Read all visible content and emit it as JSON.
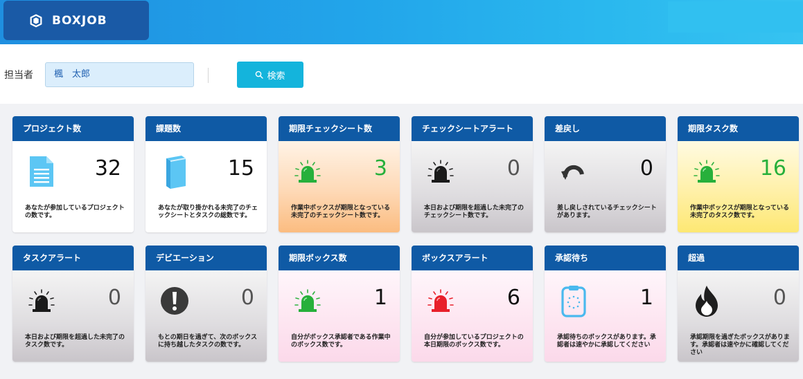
{
  "header": {
    "logo_text": "BOXJOB",
    "colors": {
      "header_gradient_start": "#1f8fe0",
      "header_gradient_end": "#36c3f1",
      "logo_bg": "#1a5aa6"
    }
  },
  "filter": {
    "assignee_label": "担当者",
    "assignee_value": "楓　太郎",
    "search_label": "検索",
    "search_icon": "search-icon"
  },
  "cards": [
    {
      "title": "プロジェクト数",
      "value": "32",
      "desc": "あなたが参加しているプロジェクトの数です。",
      "icon": "document-icon",
      "theme": "white",
      "value_color": "#111111"
    },
    {
      "title": "課題数",
      "value": "15",
      "desc": "あなたが取り掛かれる未完了のチェックシートとタスクの総数です。",
      "icon": "book-icon",
      "theme": "white",
      "value_color": "#111111"
    },
    {
      "title": "期限チェックシート数",
      "value": "3",
      "desc": "作業中ボックスが期限となっている未完了のチェックシート数です。",
      "icon": "siren-green-icon",
      "theme": "orange",
      "value_color": "#27b03b"
    },
    {
      "title": "チェックシートアラート",
      "value": "0",
      "desc": "本日および期限を超過した未完了のチェックシート数です。",
      "icon": "siren-black-icon",
      "theme": "gray",
      "value_color": "#555555"
    },
    {
      "title": "差戻し",
      "value": "0",
      "desc": "差し戻しされているチェックシートがあります。",
      "icon": "undo-arrow-icon",
      "theme": "gray",
      "value_color": "#111111"
    },
    {
      "title": "期限タスク数",
      "value": "16",
      "desc": "作業中ボックスが期限となっている未完了のタスク数です。",
      "icon": "siren-green-icon",
      "theme": "yellow",
      "value_color": "#27b03b"
    },
    {
      "title": "タスクアラート",
      "value": "0",
      "desc": "本日および期限を超過した未完了のタスク数です。",
      "icon": "siren-black-icon",
      "theme": "gray",
      "value_color": "#555555"
    },
    {
      "title": "デビエーション",
      "value": "0",
      "desc": "もとの期日を過ぎて、次のボックスに持ち越したタスクの数です。",
      "icon": "exclamation-icon",
      "theme": "gray",
      "value_color": "#555555"
    },
    {
      "title": "期限ボックス数",
      "value": "1",
      "desc": "自分がボックス承認者である作業中のボックス数です。",
      "icon": "siren-green-icon",
      "theme": "pink",
      "value_color": "#111111"
    },
    {
      "title": "ボックスアラート",
      "value": "6",
      "desc": "自分が参加しているプロジェクトの本日期限のボックス数です。",
      "icon": "siren-red-icon",
      "theme": "pink",
      "value_color": "#111111"
    },
    {
      "title": "承認待ち",
      "value": "1",
      "desc": "承認待ちのボックスがあります。承認者は速やかに承認してください",
      "icon": "clipboard-icon",
      "theme": "pink",
      "value_color": "#111111"
    },
    {
      "title": "超過",
      "value": "0",
      "desc": "承認期限を過ぎたボックスがあります。承認者は速やかに確認してください",
      "icon": "fire-icon",
      "theme": "gray",
      "value_color": "#555555"
    }
  ]
}
